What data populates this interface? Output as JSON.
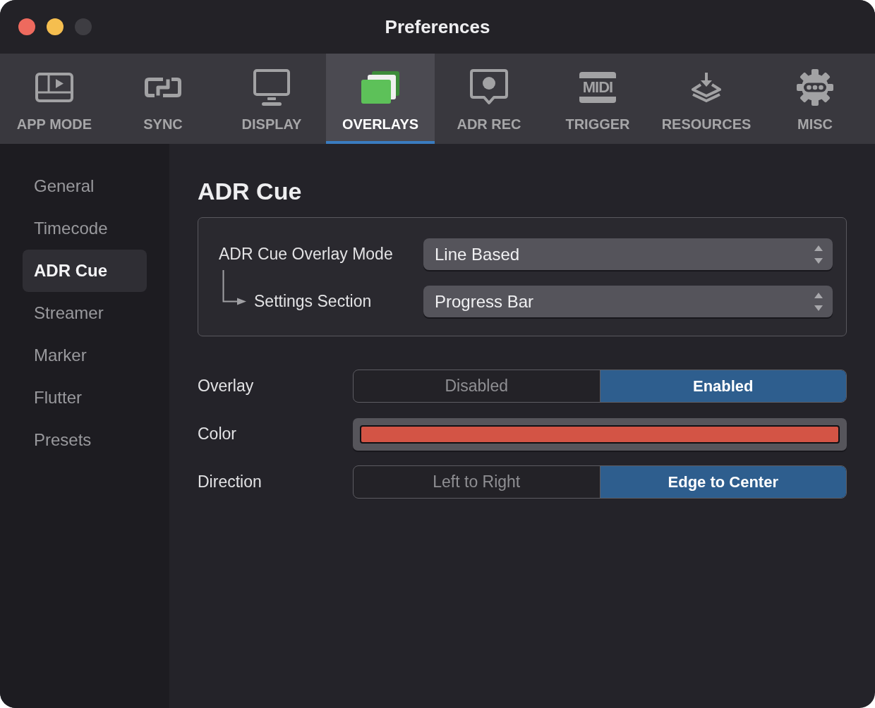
{
  "window": {
    "title": "Preferences",
    "controls": [
      {
        "color": "#ee6a5e"
      },
      {
        "color": "#f5be4f"
      },
      {
        "color": "#3e3d42"
      }
    ]
  },
  "tabs": [
    {
      "label": "APP MODE",
      "selected": false
    },
    {
      "label": "SYNC",
      "selected": false
    },
    {
      "label": "DISPLAY",
      "selected": false
    },
    {
      "label": "OVERLAYS",
      "selected": true
    },
    {
      "label": "ADR REC",
      "selected": false
    },
    {
      "label": "TRIGGER",
      "selected": false,
      "icon_text": "MIDI"
    },
    {
      "label": "RESOURCES",
      "selected": false
    },
    {
      "label": "MISC",
      "selected": false
    }
  ],
  "sidebar": {
    "items": [
      {
        "label": "General",
        "selected": false
      },
      {
        "label": "Timecode",
        "selected": false
      },
      {
        "label": "ADR Cue",
        "selected": true
      },
      {
        "label": "Streamer",
        "selected": false
      },
      {
        "label": "Marker",
        "selected": false
      },
      {
        "label": "Flutter",
        "selected": false
      },
      {
        "label": "Presets",
        "selected": false
      }
    ]
  },
  "content": {
    "heading": "ADR Cue",
    "group": {
      "rows": [
        {
          "label": "ADR Cue Overlay Mode",
          "value": "Line Based",
          "children": [
            {
              "label": "Settings Section",
              "value": "Progress Bar"
            }
          ]
        }
      ]
    }
  },
  "settings": [
    {
      "kind": "segmented",
      "label": "Overlay",
      "options": [
        {
          "label": "Disabled",
          "selected": false
        },
        {
          "label": "Enabled",
          "selected": true
        }
      ]
    },
    {
      "kind": "color",
      "label": "Color",
      "color": "#d35445"
    },
    {
      "kind": "segmented",
      "label": "Direction",
      "options": [
        {
          "label": "Left to Right",
          "selected": false
        },
        {
          "label": "Edge to Center",
          "selected": true
        }
      ]
    }
  ]
}
